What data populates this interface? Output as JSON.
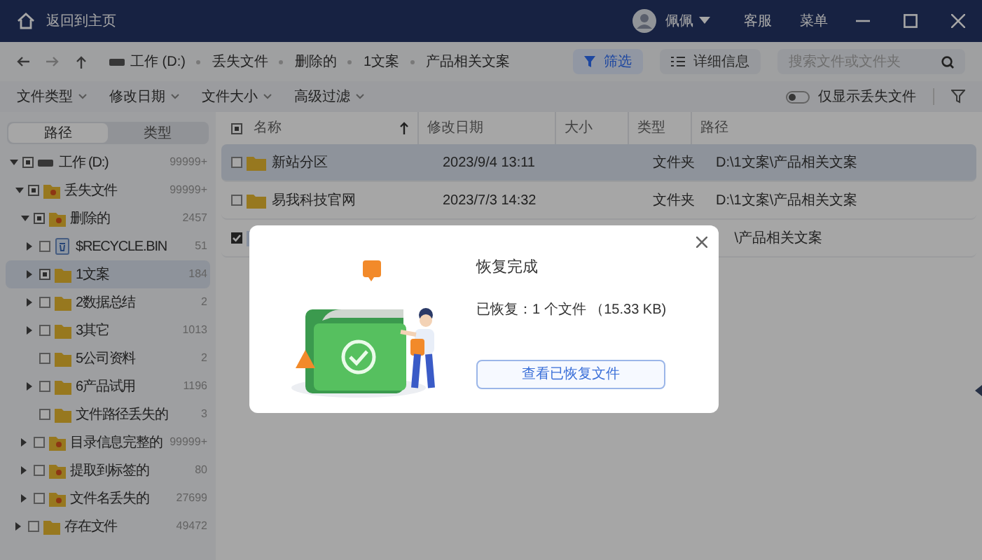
{
  "title_bar": {
    "home_link": "返回到主页",
    "user": "佩佩",
    "support": "客服",
    "menu": "菜单"
  },
  "breadcrumb": [
    "工作 (D:)",
    "丢失文件",
    "删除的",
    "1文案",
    "产品相关文案"
  ],
  "toolbar": {
    "filter_button": {
      "label": "筛选",
      "selected": true
    },
    "details_button": {
      "label": "详细信息",
      "selected": false
    },
    "search": {
      "placeholder": "搜索文件或文件夹"
    }
  },
  "filters": [
    "文件类型",
    "修改日期",
    "文件大小",
    "高级过滤"
  ],
  "lost_only_toggle": {
    "label": "仅显示丢失文件",
    "on": false
  },
  "sidebar_tabs": [
    {
      "label": "路径",
      "selected": true
    },
    {
      "label": "类型",
      "selected": false
    }
  ],
  "tree": [
    {
      "label": "工作 (D:)",
      "count": "99999+",
      "kind": "drive",
      "expanded": true,
      "partial": true,
      "selected": false,
      "children": [
        {
          "label": "丢失文件",
          "count": "99999+",
          "kind": "special",
          "expanded": true,
          "partial": true,
          "selected": false,
          "children": [
            {
              "label": "删除的",
              "count": "2457",
              "kind": "special",
              "expanded": true,
              "partial": true,
              "selected": false,
              "children": [
                {
                  "label": "$RECYCLE.BIN",
                  "count": "51",
                  "kind": "recycle",
                  "expanded": false,
                  "partial": false,
                  "selected": false
                },
                {
                  "label": "1文案",
                  "count": "184",
                  "kind": "folder",
                  "expanded": false,
                  "partial": true,
                  "selected": true
                },
                {
                  "label": "2数据总结",
                  "count": "2",
                  "kind": "folder",
                  "expanded": false,
                  "partial": false,
                  "selected": false
                },
                {
                  "label": "3其它",
                  "count": "1013",
                  "kind": "folder",
                  "expanded": false,
                  "partial": false,
                  "selected": false
                },
                {
                  "label": "5公司资料",
                  "count": "2",
                  "kind": "folder",
                  "partial": false,
                  "selected": false
                },
                {
                  "label": "6产品试用",
                  "count": "1196",
                  "kind": "folder",
                  "expanded": false,
                  "partial": false,
                  "selected": false
                },
                {
                  "label": "文件路径丢失的",
                  "count": "3",
                  "kind": "folder",
                  "partial": false,
                  "selected": false
                }
              ]
            },
            {
              "label": "目录信息完整的",
              "count": "99999+",
              "kind": "special",
              "expanded": false,
              "partial": false,
              "selected": false
            },
            {
              "label": "提取到标签的",
              "count": "80",
              "kind": "special",
              "expanded": false,
              "partial": false,
              "selected": false
            },
            {
              "label": "文件名丢失的",
              "count": "27699",
              "kind": "special",
              "expanded": false,
              "partial": false,
              "selected": false
            }
          ]
        },
        {
          "label": "存在文件",
          "count": "49472",
          "kind": "folder",
          "expanded": false,
          "partial": false,
          "selected": false
        }
      ]
    }
  ],
  "table": {
    "select_all_partial": true,
    "columns": [
      "名称",
      "修改日期",
      "大小",
      "类型",
      "路径"
    ],
    "rows": [
      {
        "kind": "folder",
        "name": "新站分区",
        "modified": "2023/9/4 13:11",
        "type": "文件夹",
        "path": "D:\\1文案\\产品相关文案",
        "checked": false,
        "selected": true
      },
      {
        "kind": "folder",
        "name": "易我科技官网",
        "modified": "2023/7/3 14:32",
        "type": "文件夹",
        "path": "D:\\1文案\\产品相关文案",
        "checked": false,
        "selected": false
      },
      {
        "kind": "file",
        "path": "\\产品相关文案",
        "checked": true,
        "selected": false
      }
    ]
  },
  "dialog": {
    "title": "恢复完成",
    "message": "已恢复：1 个文件 （15.33 KB)",
    "button": "查看已恢复文件"
  }
}
